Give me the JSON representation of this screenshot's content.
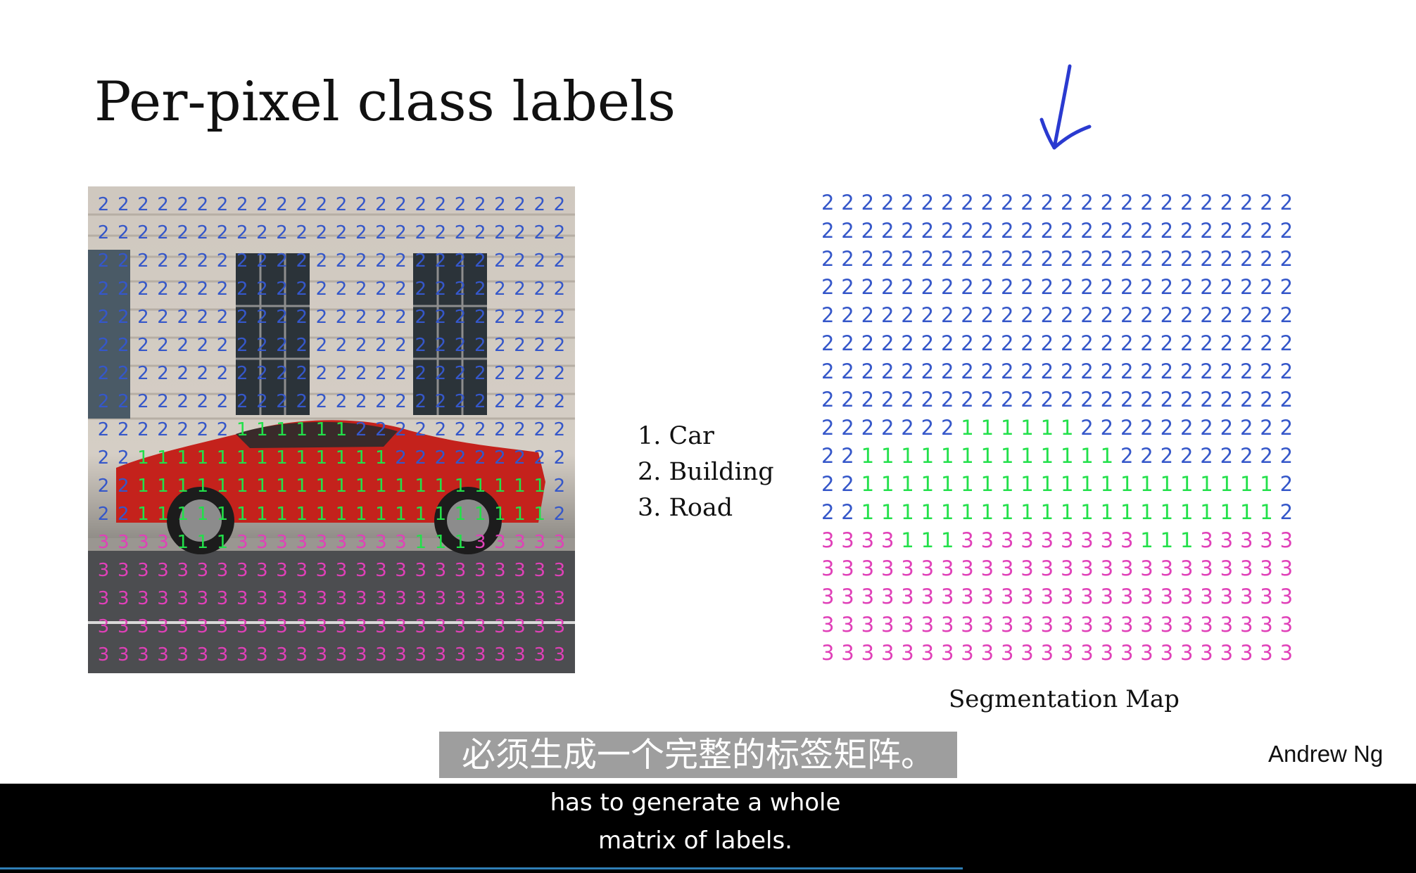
{
  "slide": {
    "title": "Per-pixel class labels",
    "legend": [
      "1. Car",
      "2. Building",
      "3. Road"
    ],
    "segmentation_caption": "Segmentation Map",
    "author": "Andrew Ng",
    "label_colors": {
      "1": "#22e04a",
      "2": "#3557c9",
      "3": "#e040b8"
    },
    "label_matrix": [
      "222222222222222222222222",
      "222222222222222222222222",
      "222222222222222222222222",
      "222222222222222222222222",
      "222222222222222222222222",
      "222222222222222222222222",
      "222222222222222222222222",
      "222222222222222222222222",
      "222222211111122222222222",
      "221111111111111222222222",
      "221111111111111111111112",
      "221111111111111111111112",
      "333311133333333311133333",
      "333333333333333333333333",
      "333333333333333333333333",
      "333333333333333333333333",
      "333333333333333333333333"
    ]
  },
  "subtitles": {
    "chinese": "必须生成一个完整的标签矩阵。",
    "english_line1": "has to generate a whole",
    "english_line2": "matrix of labels."
  },
  "player": {
    "progress": 0.68
  }
}
